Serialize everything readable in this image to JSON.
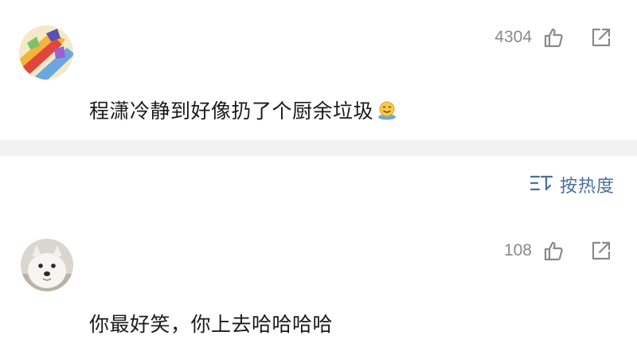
{
  "comments": [
    {
      "like_count": "4304",
      "text": "程潇冷静到好像扔了个厨余垃圾",
      "emoji": "smiling-face-emoji"
    },
    {
      "like_count": "108",
      "text": "你最好笑，你上去哈哈哈哈"
    }
  ],
  "sort": {
    "label": "按热度",
    "icon": "sort-icon"
  },
  "colors": {
    "link": "#4a6f9c",
    "count": "#8a8a8a",
    "divider": "#f2f2f2"
  }
}
